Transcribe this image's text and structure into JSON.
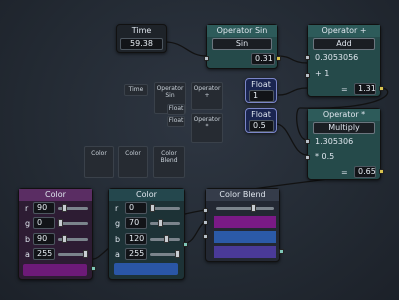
{
  "time_node": {
    "title": "Time",
    "value": "59.38"
  },
  "sin_node": {
    "title": "Operator Sin",
    "op": "Sin",
    "result": "0.31"
  },
  "add_node": {
    "title": "Operator +",
    "op": "Add",
    "a": "0.3053056",
    "sign": "+ 1",
    "eq": "=",
    "result": "1.31"
  },
  "float1": {
    "title": "Float",
    "value": "1"
  },
  "float2": {
    "title": "Float",
    "value": "0.5"
  },
  "mul_node": {
    "title": "Operator *",
    "op": "Multiply",
    "a": "1.305306",
    "sign": "* 0.5",
    "eq": "=",
    "result": "0.65"
  },
  "palette": {
    "time": "Time",
    "sin_line1": "Operator",
    "sin_line2": "Sin",
    "plus_line1": "Operator",
    "plus_line2": "+",
    "float_a": "Float",
    "float_b": "Float",
    "mul_line1": "Operator",
    "mul_line2": "*",
    "color_a": "Color",
    "color_b": "Color",
    "blend_line1": "Color",
    "blend_line2": "Blend"
  },
  "color1": {
    "title": "Color",
    "r_label": "r",
    "r": "90",
    "g_label": "g",
    "g": "0",
    "b_label": "b",
    "b": "90",
    "a_label": "a",
    "a": "255",
    "swatch": "#6d1a78"
  },
  "color2": {
    "title": "Color",
    "r_label": "r",
    "r": "0",
    "g_label": "g",
    "g": "70",
    "b_label": "b",
    "b": "120",
    "a_label": "a",
    "a": "255",
    "swatch": "#2a56a6"
  },
  "blend_node": {
    "title": "Color Blend",
    "swatch1": "#7a1a86",
    "swatch2": "#2b5aa8",
    "swatch3": "#4a3a98"
  },
  "colors": {
    "wire": "#111111",
    "accent_teal": "#2d5b5a",
    "accent_purple": "#5a2d63"
  }
}
